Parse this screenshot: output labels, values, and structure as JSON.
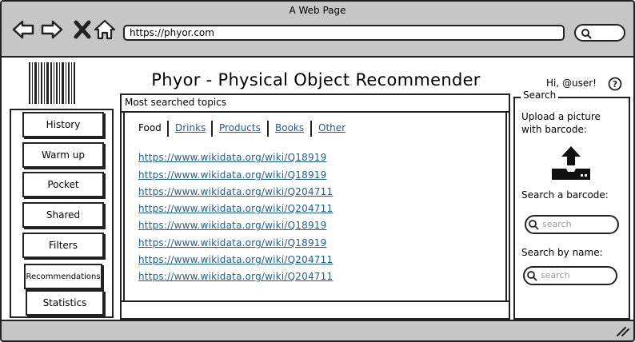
{
  "window": {
    "title": "A Web Page"
  },
  "browser": {
    "url": "https://phyor.com"
  },
  "header": {
    "app_title": "Phyor - Physical Object Recommender",
    "greeting": "Hi, @user!",
    "help_symbol": "?"
  },
  "sidebar": {
    "items": [
      {
        "label": "History"
      },
      {
        "label": "Warm up"
      },
      {
        "label": "Pocket"
      },
      {
        "label": "Shared"
      },
      {
        "label": "Filters"
      },
      {
        "label": "Recommendations"
      },
      {
        "label": "Statistics"
      }
    ]
  },
  "main": {
    "heading": "Most searched topics",
    "tabs": [
      {
        "label": "Food",
        "selected": true
      },
      {
        "label": "Drinks",
        "selected": false
      },
      {
        "label": "Products",
        "selected": false
      },
      {
        "label": "Books",
        "selected": false
      },
      {
        "label": "Other",
        "selected": false
      }
    ],
    "links": [
      "https://www.wikidata.org/wiki/Q18919",
      "https://www.wikidata.org/wiki/Q18919",
      "https://www.wikidata.org/wiki/Q204711",
      "https://www.wikidata.org/wiki/Q204711",
      "https://www.wikidata.org/wiki/Q18919",
      "https://www.wikidata.org/wiki/Q18919",
      "https://www.wikidata.org/wiki/Q204711",
      "https://www.wikidata.org/wiki/Q204711"
    ]
  },
  "search_panel": {
    "legend": "Search",
    "upload_line1": "Upload a picture",
    "upload_line2": "with barcode:",
    "upload_icon": "upload-icon",
    "barcode_label": "Search a barcode:",
    "barcode_placeholder": "search",
    "name_label": "Search by name:",
    "name_placeholder": "search"
  },
  "colors": {
    "chrome": "#c6c6c6",
    "link": "#1f5e8c",
    "border": "#222222"
  }
}
